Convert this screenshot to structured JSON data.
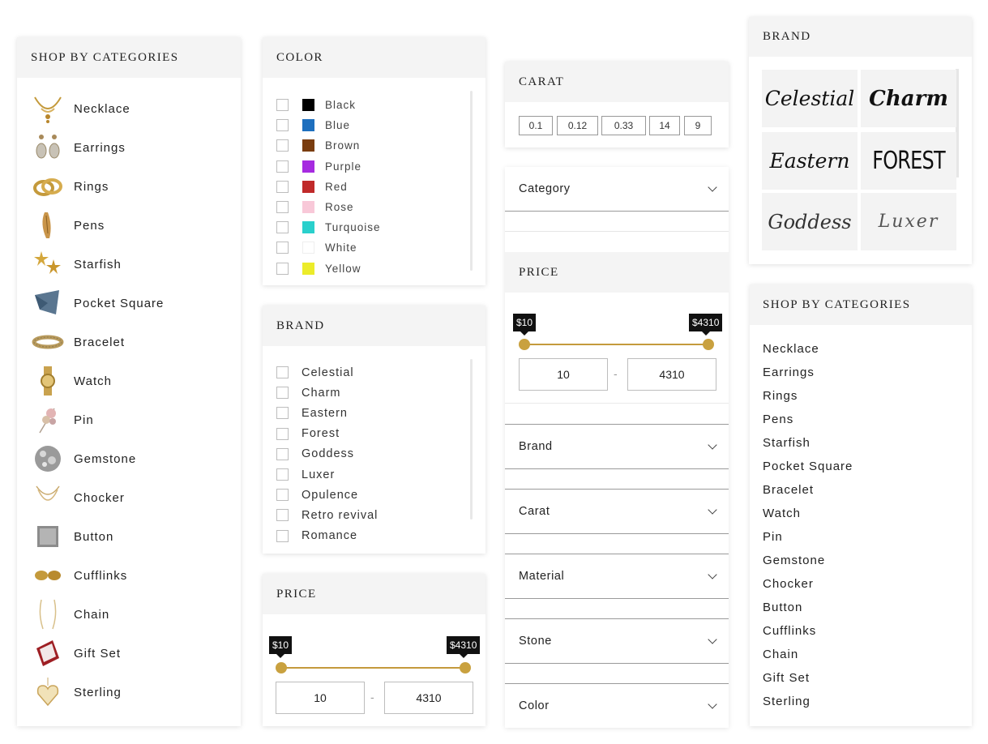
{
  "categories_panel": {
    "title": "SHOP BY CATEGORIES",
    "items": [
      {
        "label": "Necklace",
        "icon": "necklace-icon"
      },
      {
        "label": "Earrings",
        "icon": "earrings-icon"
      },
      {
        "label": "Rings",
        "icon": "rings-icon"
      },
      {
        "label": "Pens",
        "icon": "pen-icon"
      },
      {
        "label": "Starfish",
        "icon": "starfish-icon"
      },
      {
        "label": "Pocket Square",
        "icon": "pocket-square-icon"
      },
      {
        "label": "Bracelet",
        "icon": "bracelet-icon"
      },
      {
        "label": "Watch",
        "icon": "watch-icon"
      },
      {
        "label": "Pin",
        "icon": "pin-icon"
      },
      {
        "label": "Gemstone",
        "icon": "gemstone-icon"
      },
      {
        "label": "Chocker",
        "icon": "chocker-icon"
      },
      {
        "label": "Button",
        "icon": "button-icon"
      },
      {
        "label": "Cufflinks",
        "icon": "cufflinks-icon"
      },
      {
        "label": "Chain",
        "icon": "chain-icon"
      },
      {
        "label": "Gift Set",
        "icon": "gift-set-icon"
      },
      {
        "label": "Sterling",
        "icon": "sterling-icon"
      }
    ]
  },
  "color_panel": {
    "title": "COLOR",
    "items": [
      {
        "label": "Black",
        "color": "#000000"
      },
      {
        "label": "Blue",
        "color": "#1e6fbe"
      },
      {
        "label": "Brown",
        "color": "#7a3d0f"
      },
      {
        "label": "Purple",
        "color": "#a62be0"
      },
      {
        "label": "Red",
        "color": "#c02a2a"
      },
      {
        "label": "Rose",
        "color": "#f8c8d8"
      },
      {
        "label": "Turquoise",
        "color": "#2ad0cc"
      },
      {
        "label": "White",
        "color": "#ffffff"
      },
      {
        "label": "Yellow",
        "color": "#ecec2a"
      }
    ]
  },
  "brand_panel": {
    "title": "BRAND",
    "items": [
      "Celestial",
      "Charm",
      "Eastern",
      "Forest",
      "Goddess",
      "Luxer",
      "Opulence",
      "Retro revival",
      "Romance"
    ]
  },
  "price_panel_left": {
    "title": "PRICE",
    "min_tip": "$10",
    "max_tip": "$4310",
    "min_value": "10",
    "max_value": "4310",
    "separator": "-",
    "range_fraction": [
      0,
      1
    ]
  },
  "carat_panel": {
    "title": "CARAT",
    "values": [
      "0.1",
      "0.12",
      "0.33",
      "14",
      "9"
    ]
  },
  "filter_column": {
    "category_label": "Category",
    "price": {
      "title": "PRICE",
      "min_tip": "$10",
      "max_tip": "$4310",
      "min_value": "10",
      "max_value": "4310",
      "separator": "-",
      "range_fraction": [
        0,
        1
      ]
    },
    "accordions": [
      "Brand",
      "Carat",
      "Material",
      "Stone",
      "Color"
    ]
  },
  "brand_logos_panel": {
    "title": "BRAND",
    "logos": [
      "Celestial",
      "Charm",
      "Eastern",
      "FOREST",
      "Goddess",
      "Luxer"
    ]
  },
  "categories_plain_panel": {
    "title": "SHOP BY CATEGORIES",
    "items": [
      "Necklace",
      "Earrings",
      "Rings",
      "Pens",
      "Starfish",
      "Pocket Square",
      "Bracelet",
      "Watch",
      "Pin",
      "Gemstone",
      "Chocker",
      "Button",
      "Cufflinks",
      "Chain",
      "Gift Set",
      "Sterling"
    ]
  }
}
